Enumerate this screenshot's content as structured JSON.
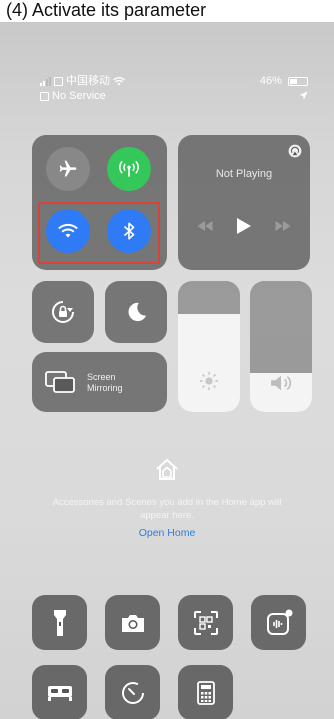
{
  "caption": "(4) Activate its parameter",
  "status": {
    "carrier": "中国移动",
    "service": "No Service",
    "battery": "46%",
    "battery_level": 0.46
  },
  "connectivity": {
    "airplane": {
      "icon": "airplane-icon",
      "active": false
    },
    "cellular": {
      "icon": "cellular-antenna-icon",
      "active": true,
      "color": "#34c759"
    },
    "wifi": {
      "icon": "wifi-icon",
      "active": true,
      "color": "#2f7bf6"
    },
    "bluetooth": {
      "icon": "bluetooth-icon",
      "active": true,
      "color": "#2f7bf6"
    },
    "highlight_color": "#d8433b"
  },
  "media": {
    "status": "Not Playing",
    "airplay_icon": "airplay-icon",
    "controls": [
      "rewind-icon",
      "play-icon",
      "fast-forward-icon"
    ]
  },
  "toggles": {
    "rotation_lock": "rotation-lock-icon",
    "do_not_disturb": "moon-icon"
  },
  "screen_mirroring": {
    "label_line1": "Screen",
    "label_line2": "Mirroring",
    "icon": "screen-mirroring-icon"
  },
  "brightness": {
    "level": 0.75,
    "icon": "sun-icon"
  },
  "volume": {
    "level": 0.3,
    "icon": "speaker-icon"
  },
  "home": {
    "icon": "home-icon",
    "message": "Accessories and Scenes you add in the Home app will appear here.",
    "link": "Open Home"
  },
  "shortcuts": [
    "flashlight-icon",
    "camera-icon",
    "qr-code-scanner-icon",
    "voice-memo-icon",
    "sleep-bed-icon",
    "timer-icon",
    "calculator-icon"
  ]
}
